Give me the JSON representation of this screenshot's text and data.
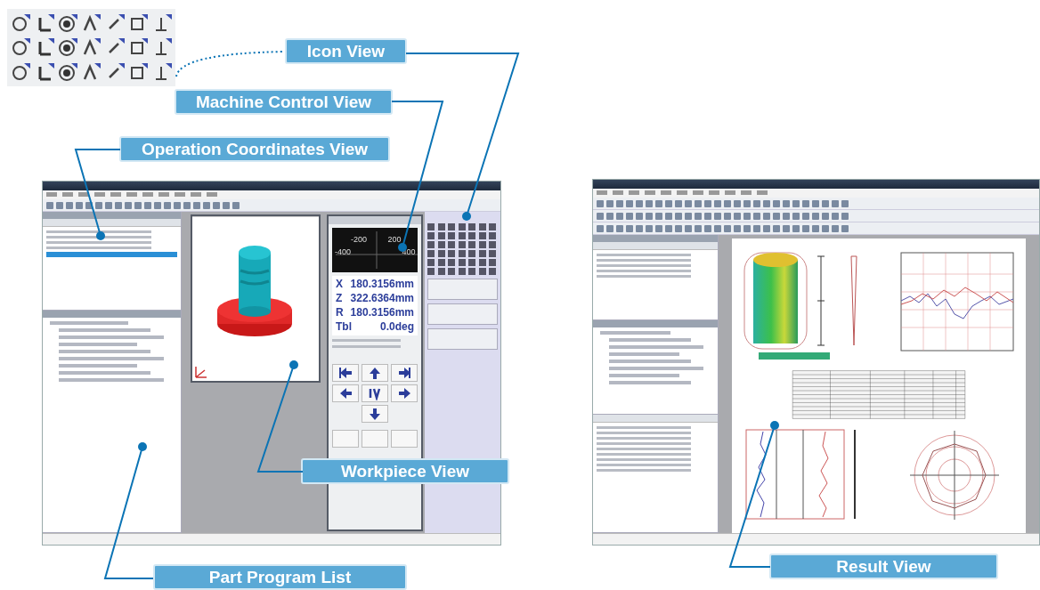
{
  "callouts": [
    {
      "label": "Icon View"
    },
    {
      "label": "Machine Control View"
    },
    {
      "label": "Operation Coordinates View"
    },
    {
      "label": "Workpiece View"
    },
    {
      "label": "Part Program List"
    },
    {
      "label": "Result View"
    }
  ],
  "machine_control": {
    "scale_labels": [
      "-200",
      "200",
      "-400",
      "400"
    ],
    "readouts": [
      {
        "axis": "X",
        "value": "180.3156mm"
      },
      {
        "axis": "Z",
        "value": "322.6364mm"
      },
      {
        "axis": "R",
        "value": "180.3156mm"
      },
      {
        "axis": "Tbl",
        "value": "0.0deg"
      }
    ]
  }
}
